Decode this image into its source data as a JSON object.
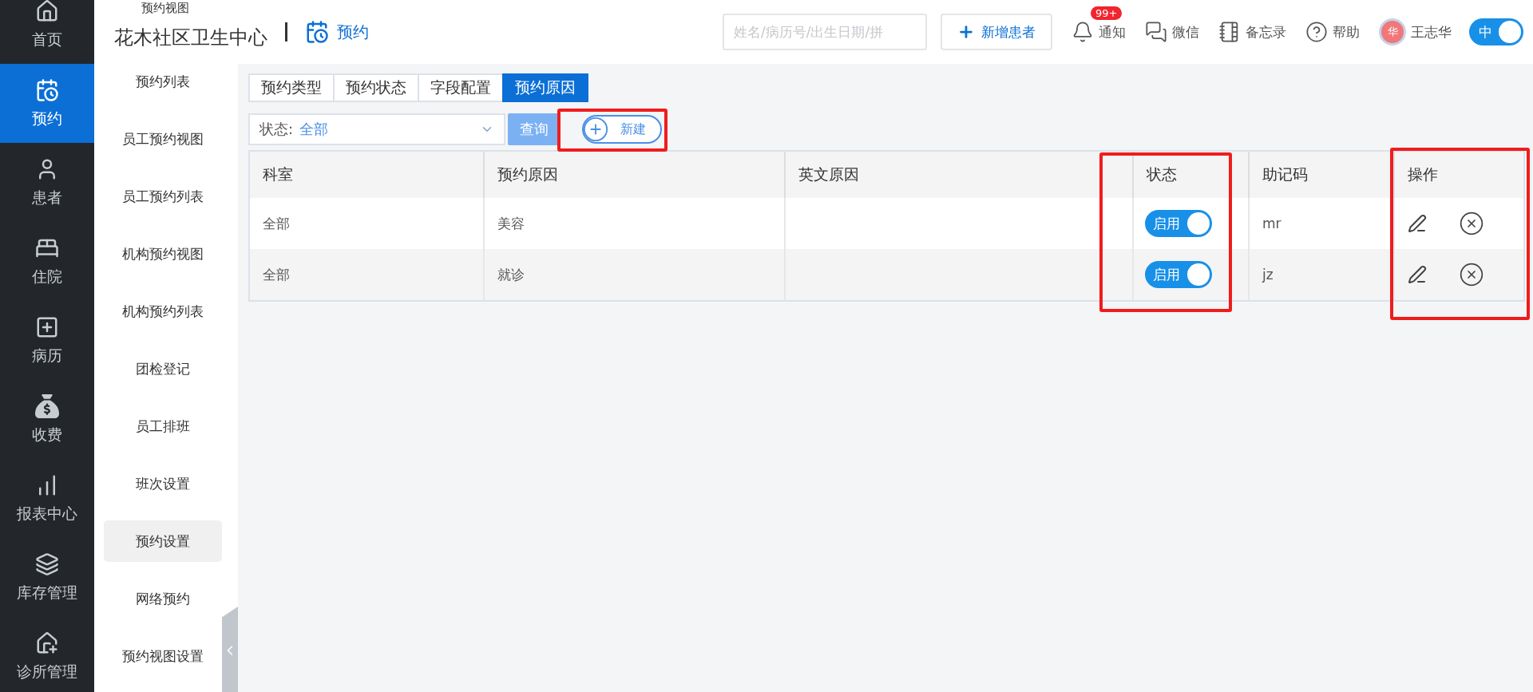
{
  "nav": [
    {
      "label": "首页",
      "selected": false
    },
    {
      "label": "预约",
      "selected": true
    },
    {
      "label": "患者",
      "selected": false
    },
    {
      "label": "住院",
      "selected": false
    },
    {
      "label": "病历",
      "selected": false
    },
    {
      "label": "收费",
      "selected": false
    },
    {
      "label": "报表中心",
      "selected": false
    },
    {
      "label": "库存管理",
      "selected": false
    },
    {
      "label": "诊所管理",
      "selected": false
    }
  ],
  "header": {
    "clinic": "花木社区卫生中心",
    "module": "预约",
    "search": {
      "placeholder": "姓名/病历号/出生日期/拼"
    },
    "add_patient": "新增患者",
    "notify": {
      "label": "通知",
      "badge": "99+"
    },
    "wechat": "微信",
    "memo": "备忘录",
    "help": "帮助",
    "avatar": "华",
    "user": "王志华",
    "lang_toggle": {
      "label": "中",
      "on": true
    }
  },
  "subnav": [
    {
      "label": "预约视图",
      "selected": false
    },
    {
      "label": "预约列表",
      "selected": false
    },
    {
      "label": "员工预约视图",
      "selected": false
    },
    {
      "label": "员工预约列表",
      "selected": false
    },
    {
      "label": "机构预约视图",
      "selected": false
    },
    {
      "label": "机构预约列表",
      "selected": false
    },
    {
      "label": "团检登记",
      "selected": false
    },
    {
      "label": "员工排班",
      "selected": false
    },
    {
      "label": "班次设置",
      "selected": false
    },
    {
      "label": "预约设置",
      "selected": true
    },
    {
      "label": "网络预约",
      "selected": false
    },
    {
      "label": "预约视图设置",
      "selected": false
    }
  ],
  "tabs": [
    {
      "label": "预约类型",
      "selected": false
    },
    {
      "label": "预约状态",
      "selected": false
    },
    {
      "label": "字段配置",
      "selected": false
    },
    {
      "label": "预约原因",
      "selected": true
    }
  ],
  "filter": {
    "label": "状态:",
    "value": "全部",
    "query": "查询",
    "new": "新建"
  },
  "table": {
    "columns": [
      "科室",
      "预约原因",
      "英文原因",
      "状态",
      "助记码",
      "操作"
    ],
    "rows": [
      {
        "dept": "全部",
        "reason": "美容",
        "english": "",
        "status": {
          "label": "启用",
          "on": true
        },
        "code": "mr"
      },
      {
        "dept": "全部",
        "reason": "就诊",
        "english": "",
        "status": {
          "label": "启用",
          "on": true
        },
        "code": "jz"
      }
    ]
  },
  "highlights": {
    "new_button": true,
    "status_column": true,
    "actions_column": true
  }
}
